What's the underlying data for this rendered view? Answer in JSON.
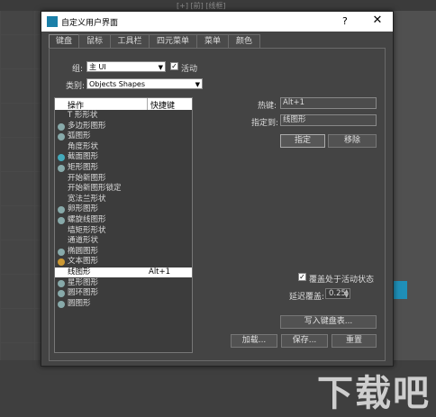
{
  "viewport": {
    "label": "[+] [前] [线框]",
    "watermark": "下载吧"
  },
  "dialog": {
    "title": "自定义用户界面",
    "help": "?",
    "close": "✕",
    "tabs": [
      "键盘",
      "鼠标",
      "工具栏",
      "四元菜单",
      "菜单",
      "颜色"
    ],
    "active_tab": "键盘",
    "group_label": "组:",
    "group_value": "主 UI",
    "active_label": "活动",
    "active_checked": true,
    "category_label": "类别:",
    "category_value": "Objects Shapes",
    "list": {
      "col_action": "操作",
      "col_shortcut": "快捷键",
      "items": [
        {
          "name": "T 形形状",
          "key": "",
          "icon": ""
        },
        {
          "name": "多边形图形",
          "key": "",
          "icon": "#8aa"
        },
        {
          "name": "弧图形",
          "key": "",
          "icon": "#8aa"
        },
        {
          "name": "角度形状",
          "key": "",
          "icon": ""
        },
        {
          "name": "截面图形",
          "key": "",
          "icon": "#4ab"
        },
        {
          "name": "矩形图形",
          "key": "",
          "icon": "#8aa"
        },
        {
          "name": "开始新图形",
          "key": "",
          "icon": ""
        },
        {
          "name": "开始新图形锁定",
          "key": "",
          "icon": ""
        },
        {
          "name": "宽法兰形状",
          "key": "",
          "icon": ""
        },
        {
          "name": "卵形图形",
          "key": "",
          "icon": "#8aa"
        },
        {
          "name": "螺旋线图形",
          "key": "",
          "icon": "#8aa"
        },
        {
          "name": "墙矩形形状",
          "key": "",
          "icon": ""
        },
        {
          "name": "通道形状",
          "key": "",
          "icon": ""
        },
        {
          "name": "椭圆图形",
          "key": "",
          "icon": "#8aa"
        },
        {
          "name": "文本图形",
          "key": "",
          "icon": "#c93"
        },
        {
          "name": "线图形",
          "key": "Alt+1",
          "icon": ""
        },
        {
          "name": "星形图形",
          "key": "",
          "icon": "#8aa"
        },
        {
          "name": "圆环图形",
          "key": "",
          "icon": "#8aa"
        },
        {
          "name": "圆图形",
          "key": "",
          "icon": "#8aa"
        }
      ],
      "selected_index": 15
    },
    "hotkey_label": "热键:",
    "hotkey_value": "Alt+1",
    "assigned_label": "指定到:",
    "assigned_value": "线图形",
    "assign_button": "指定",
    "remove_button": "移除",
    "override_label": "覆盖处于活动状态",
    "override_checked": true,
    "delay_label": "延迟覆盖:",
    "delay_value": "0.25",
    "write_button": "写入键盘表...",
    "load_button": "加载...",
    "save_button": "保存...",
    "reset_button": "重置"
  }
}
